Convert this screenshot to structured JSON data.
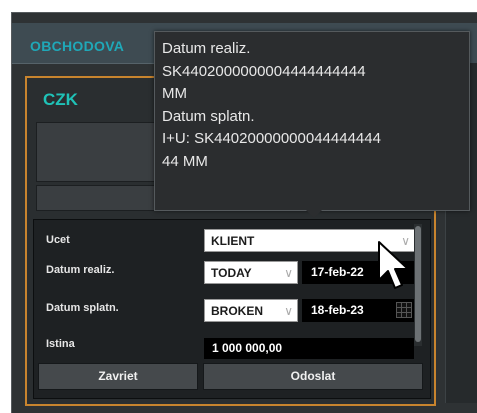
{
  "window": {
    "title": "OBCHODOVA"
  },
  "panel": {
    "currency": "CZK"
  },
  "form": {
    "account": {
      "label": "Ucet",
      "value": "KLIENT"
    },
    "value_date": {
      "label": "Datum realiz.",
      "type": "TODAY",
      "date": "17-feb-22"
    },
    "maturity_date": {
      "label": "Datum splatn.",
      "type": "BROKEN",
      "date": "18-feb-23"
    },
    "principal": {
      "label": "Istina",
      "value": "1 000 000,00"
    }
  },
  "actions": {
    "close_label": "Zavriet",
    "send_label": "Odoslat"
  },
  "tooltip": {
    "lines": [
      "Datum realiz.",
      "SK4402000000004444444444",
      "MM",
      "Datum splatn.",
      "I+U: SK44020000000044444444",
      "44 MM"
    ]
  },
  "colors": {
    "accent_teal": "#1fc2b7",
    "panel_border": "#c8842e",
    "background": "#2e3234"
  },
  "icons": {
    "dropdown": "chevron-down-icon",
    "calendar": "calendar-icon",
    "cursor": "mouse-pointer-icon"
  }
}
